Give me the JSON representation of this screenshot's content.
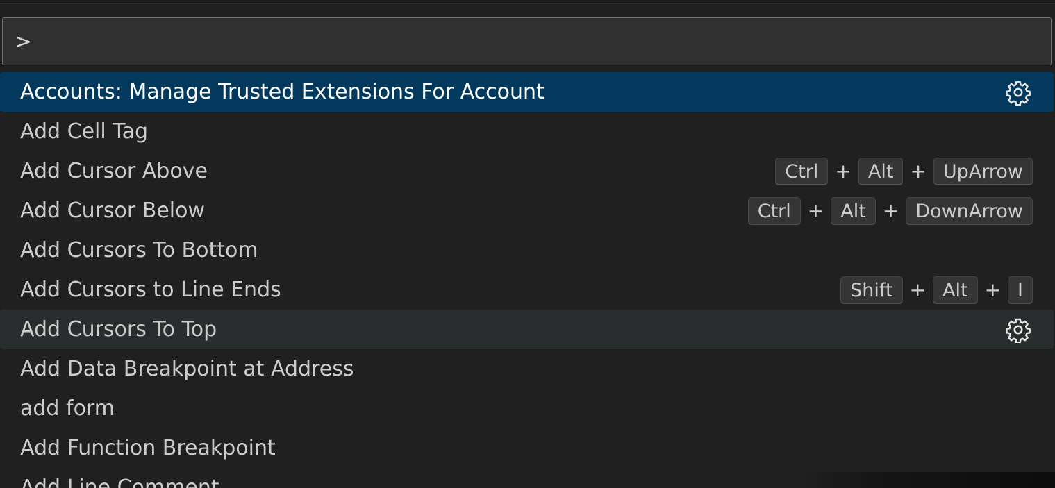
{
  "quick_open": {
    "input_value": ">"
  },
  "commands": [
    {
      "label": "Accounts: Manage Trusted Extensions For Account",
      "state": "selected",
      "keys": [],
      "gear": true
    },
    {
      "label": "Add Cell Tag",
      "state": "",
      "keys": [],
      "gear": false
    },
    {
      "label": "Add Cursor Above",
      "state": "",
      "keys": [
        "Ctrl",
        "Alt",
        "UpArrow"
      ],
      "gear": false
    },
    {
      "label": "Add Cursor Below",
      "state": "",
      "keys": [
        "Ctrl",
        "Alt",
        "DownArrow"
      ],
      "gear": false
    },
    {
      "label": "Add Cursors To Bottom",
      "state": "",
      "keys": [],
      "gear": false
    },
    {
      "label": "Add Cursors to Line Ends",
      "state": "",
      "keys": [
        "Shift",
        "Alt",
        "I"
      ],
      "gear": false
    },
    {
      "label": "Add Cursors To Top",
      "state": "hover",
      "keys": [],
      "gear": true
    },
    {
      "label": "Add Data Breakpoint at Address",
      "state": "",
      "keys": [],
      "gear": false
    },
    {
      "label": "add form",
      "state": "",
      "keys": [],
      "gear": false
    },
    {
      "label": "Add Function Breakpoint",
      "state": "",
      "keys": [],
      "gear": false
    },
    {
      "label": "Add Line Comment",
      "state": "",
      "keys": [],
      "gear": false
    }
  ],
  "key_separator": "+",
  "icons": {
    "configure": "gear-icon"
  },
  "colors": {
    "background": "#202020",
    "input_border": "#3f79c9",
    "selected_row": "#04395e",
    "hover_row": "#2a2d2e"
  }
}
